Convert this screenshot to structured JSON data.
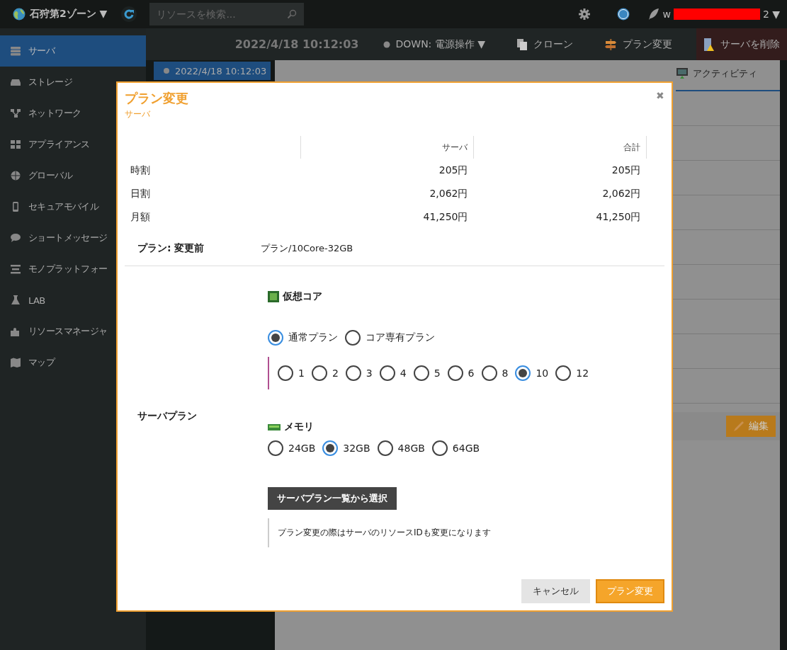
{
  "topbar": {
    "zone": "石狩第2ゾーン ▼",
    "search_placeholder": "リソースを検索...",
    "user_prefix": "w",
    "user_suffix": "2 ▼"
  },
  "sidebar": {
    "items": [
      {
        "label": "サーバ",
        "selected": true
      },
      {
        "label": "ストレージ",
        "selected": false
      },
      {
        "label": "ネットワーク",
        "selected": false
      },
      {
        "label": "アプライアンス",
        "selected": false
      },
      {
        "label": "グローバル",
        "selected": false
      },
      {
        "label": "セキュアモバイル",
        "selected": false
      },
      {
        "label": "ショートメッセージ",
        "selected": false
      },
      {
        "label": "モノプラットフォー",
        "selected": false
      },
      {
        "label": "LAB",
        "selected": false
      },
      {
        "label": "リソースマネージャ",
        "selected": false
      },
      {
        "label": "マップ",
        "selected": false
      }
    ]
  },
  "toolbar": {
    "timestamp": "2022/4/18 10:12:03",
    "actions": [
      {
        "label": "DOWN: 電源操作 ▼",
        "kind": "power"
      },
      {
        "label": "クローン",
        "kind": "clone"
      },
      {
        "label": "プラン変更",
        "kind": "plan"
      },
      {
        "label": "サーバを削除",
        "kind": "delete"
      }
    ]
  },
  "server_list": [
    {
      "label": "2022/4/18 10:12:03",
      "selected": true
    }
  ],
  "detail": {
    "tabs": [
      {
        "label": "アクティビティ",
        "selected": false
      }
    ],
    "edit_button": "編集"
  },
  "dialog": {
    "title": "プラン変更",
    "subtitle": "サーバ",
    "close": "✖",
    "price_table": {
      "columns": [
        "",
        "サーバ",
        "合計"
      ],
      "rows": [
        [
          "時割",
          "205円",
          "205円"
        ],
        [
          "日割",
          "2,062円",
          "2,062円"
        ],
        [
          "月額",
          "41,250円",
          "41,250円"
        ]
      ]
    },
    "current_plan": {
      "label": "プラン: 変更前",
      "value": "プラン/10Core-32GB"
    },
    "server_plan": {
      "label": "サーバプラン",
      "cpu": {
        "title": "仮想コア",
        "plan_types": [
          {
            "label": "通常プラン",
            "selected": true
          },
          {
            "label": "コア専有プラン",
            "selected": false
          }
        ],
        "cores": [
          {
            "label": "1",
            "selected": false
          },
          {
            "label": "2",
            "selected": false
          },
          {
            "label": "3",
            "selected": false
          },
          {
            "label": "4",
            "selected": false
          },
          {
            "label": "5",
            "selected": false
          },
          {
            "label": "6",
            "selected": false
          },
          {
            "label": "8",
            "selected": false
          },
          {
            "label": "10",
            "selected": true
          },
          {
            "label": "12",
            "selected": false
          }
        ]
      },
      "memory": {
        "title": "メモリ",
        "options": [
          {
            "label": "24GB",
            "selected": false
          },
          {
            "label": "32GB",
            "selected": true
          },
          {
            "label": "48GB",
            "selected": false
          },
          {
            "label": "64GB",
            "selected": false
          }
        ]
      },
      "select_button": "サーバプラン一覧から選択",
      "note": "プラン変更の際はサーバのリソースIDも変更になります"
    },
    "buttons": [
      {
        "label": "キャンセル",
        "kind": "secondary"
      },
      {
        "label": "プラン変更",
        "kind": "primary"
      }
    ]
  }
}
